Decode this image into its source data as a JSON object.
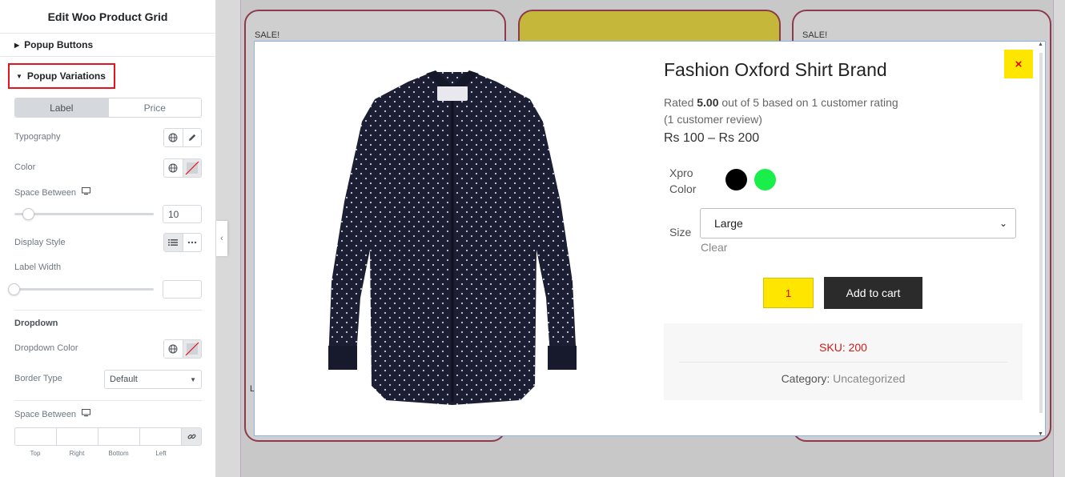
{
  "panel": {
    "title": "Edit Woo Product Grid",
    "section_buttons": "Popup Buttons",
    "section_variations": "Popup Variations",
    "tabs": [
      "Label",
      "Price"
    ],
    "typography_label": "Typography",
    "color_label": "Color",
    "space_between_label": "Space Between",
    "space_between_value": "10",
    "display_style_label": "Display Style",
    "label_width_label": "Label Width",
    "dropdown_heading": "Dropdown",
    "dropdown_color_label": "Dropdown Color",
    "border_type_label": "Border Type",
    "border_type_value": "Default",
    "space_between_2_label": "Space Between",
    "dims": [
      "Top",
      "Right",
      "Bottom",
      "Left"
    ]
  },
  "preview": {
    "sale_badges": [
      "SALE!",
      "SALE!"
    ],
    "card_letter": "L"
  },
  "modal": {
    "close_symbol": "×",
    "product_title": "Fashion Oxford Shirt Brand",
    "rating_prefix": "Rated ",
    "rating_value": "5.00",
    "rating_suffix": " out of 5 based on 1 customer rating",
    "review_count": "(1 customer review)",
    "price": "Rs 100 – Rs 200",
    "color_label_1": "Xpro",
    "color_label_2": "Color",
    "swatches": [
      "#000000",
      "#1aee4a"
    ],
    "size_label": "Size",
    "size_value": "Large",
    "clear_label": "Clear",
    "qty": "1",
    "add_to_cart": "Add to cart",
    "sku_label": "SKU: 200",
    "category_label": "Category: ",
    "category_value": "Uncategorized"
  },
  "colors": {
    "accent_yellow": "#ffe600",
    "close_red": "#e50000",
    "highlight_red": "#e8121c",
    "button_dark": "#2b2b2b"
  }
}
